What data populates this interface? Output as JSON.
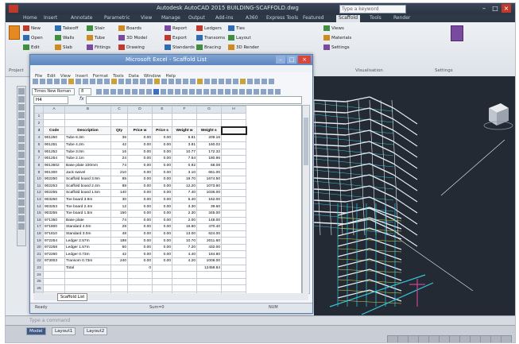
{
  "app": {
    "title": "Autodesk AutoCAD 2015  BUILDING-SCAFFOLD.dwg",
    "help_search_placeholder": "Type a keyword",
    "window_controls": [
      "–",
      "□",
      "×"
    ]
  },
  "ribbon_tabs": [
    "Home",
    "Insert",
    "Annotate",
    "Parametric",
    "View",
    "Manage",
    "Output",
    "Add-ins",
    "A360",
    "Express Tools",
    "Featured",
    "Scaffold",
    "Tools",
    "Render"
  ],
  "active_tab": "Scaffold",
  "ribbon_buttons": [
    "New",
    "Open",
    "Edit",
    "Takeoff",
    "Walls",
    "Slab",
    "Stair",
    "Tube",
    "Fittings",
    "Boards",
    "3D Model",
    "Drawing",
    "Report",
    "Export",
    "Standards",
    "Ledgers",
    "Transoms",
    "Bracing",
    "Ties",
    "Layout",
    "3D Render",
    "Views",
    "Materials",
    "Settings"
  ],
  "ribbon_panels": [
    "Project",
    "Components",
    "Output",
    "Visualisation",
    "Settings"
  ],
  "excel": {
    "title": "Microsoft Excel - Scaffold List",
    "menu": [
      "File",
      "Edit",
      "View",
      "Insert",
      "Format",
      "Tools",
      "Data",
      "Window",
      "Help"
    ],
    "font_name": "Times New Roman",
    "font_size": "8",
    "name_box": "H4",
    "fx_label": "fx",
    "columns": [
      "",
      "A",
      "B",
      "C",
      "D",
      "E",
      "F",
      "G",
      "H"
    ],
    "header": [
      "Code",
      "Description",
      "Qty",
      "Price w",
      "Price s",
      "Weight w",
      "Weight s"
    ],
    "rows": [
      [
        "1",
        "",
        "",
        "",
        "",
        "",
        "",
        "",
        ""
      ],
      [
        "2",
        "",
        "",
        "",
        "",
        "",
        "",
        "",
        ""
      ],
      [
        "3",
        "Code",
        "Description",
        "Qty",
        "Price w",
        "Price s",
        "Weight w",
        "Weight s"
      ],
      [
        "4",
        "901250",
        "Tube 6.3m",
        "36",
        "0.00",
        "0.00",
        "5.81",
        "209.16"
      ],
      [
        "5",
        "901251",
        "Tube 4.2m",
        "42",
        "0.00",
        "0.00",
        "3.81",
        "160.02"
      ],
      [
        "6",
        "901252",
        "Tube 3.0m",
        "16",
        "0.00",
        "0.00",
        "10.77",
        "172.32"
      ],
      [
        "7",
        "901254",
        "Tube 2.1m",
        "24",
        "0.00",
        "0.00",
        "7.54",
        "180.96"
      ],
      [
        "8",
        "9013602",
        "Base plate 100mm",
        "74",
        "0.00",
        "0.00",
        "0.92",
        "68.08"
      ],
      [
        "9",
        "901300",
        "Jack swivel",
        "210",
        "0.00",
        "0.00",
        "3.10",
        "651.00"
      ],
      [
        "10",
        "902250",
        "Scaffold board 3.9m",
        "85",
        "0.00",
        "0.00",
        "19.70",
        "1674.50"
      ],
      [
        "11",
        "902253",
        "Scaffold board 2.4m",
        "88",
        "0.00",
        "0.00",
        "12.20",
        "1073.60"
      ],
      [
        "12",
        "902255",
        "Scaffold board 1.5m",
        "140",
        "0.00",
        "0.00",
        "7.40",
        "1036.00"
      ],
      [
        "13",
        "903250",
        "Toe board 3.9m",
        "30",
        "0.00",
        "0.00",
        "5.40",
        "162.00"
      ],
      [
        "14",
        "903253",
        "Toe board 2.4m",
        "12",
        "0.00",
        "0.00",
        "3.30",
        "39.60"
      ],
      [
        "15",
        "903255",
        "Toe board 1.5m",
        "150",
        "0.00",
        "0.00",
        "2.30",
        "345.00"
      ],
      [
        "16",
        "971350",
        "Base plate",
        "74",
        "0.00",
        "0.00",
        "2.00",
        "148.00"
      ],
      [
        "17",
        "971800",
        "Standard 4.0m",
        "28",
        "0.00",
        "0.00",
        "16.80",
        "470.40"
      ],
      [
        "18",
        "971810",
        "Standard 3.0m",
        "48",
        "0.00",
        "0.00",
        "13.00",
        "624.00"
      ],
      [
        "19",
        "972254",
        "Ledger 2.57m",
        "188",
        "0.00",
        "0.00",
        "10.70",
        "2011.60"
      ],
      [
        "20",
        "972258",
        "Ledger 1.57m",
        "60",
        "0.00",
        "0.00",
        "7.20",
        "432.00"
      ],
      [
        "21",
        "972260",
        "Ledger 0.73m",
        "42",
        "0.00",
        "0.00",
        "4.40",
        "184.80"
      ],
      [
        "22",
        "973003",
        "Transom 0.73m",
        "240",
        "0.00",
        "0.00",
        "4.20",
        "1008.00"
      ],
      [
        "23",
        "",
        "Total",
        "",
        "0",
        "",
        "",
        "12458.84"
      ],
      [
        "24",
        "",
        "",
        "",
        "",
        "",
        "",
        "",
        ""
      ],
      [
        "25",
        "",
        "",
        "",
        "",
        "",
        "",
        "",
        ""
      ],
      [
        "26",
        "",
        "",
        "",
        "",
        "",
        "",
        "",
        ""
      ],
      [
        "27",
        "",
        "",
        "",
        "",
        "",
        "",
        "",
        ""
      ],
      [
        "28",
        "",
        "",
        "",
        "",
        "",
        "",
        "",
        ""
      ],
      [
        "29",
        "",
        "",
        "",
        "",
        "",
        "",
        "",
        ""
      ]
    ],
    "sheet_tab": "Scaffold List",
    "status": [
      "Ready",
      "Sum=0",
      "NUM"
    ]
  },
  "command_line": {
    "placeholder": "Type a command"
  },
  "layout_tabs": [
    "Model",
    "Layout1",
    "Layout2"
  ],
  "active_layout": "Model",
  "colors": {
    "viewport_bg": "#232a33",
    "scaffold_white": "#e6ecf2",
    "scaffold_cyan": "#38c6d9",
    "scaffold_yellow": "#d8d84a",
    "scaffold_magenta": "#c6449a"
  }
}
